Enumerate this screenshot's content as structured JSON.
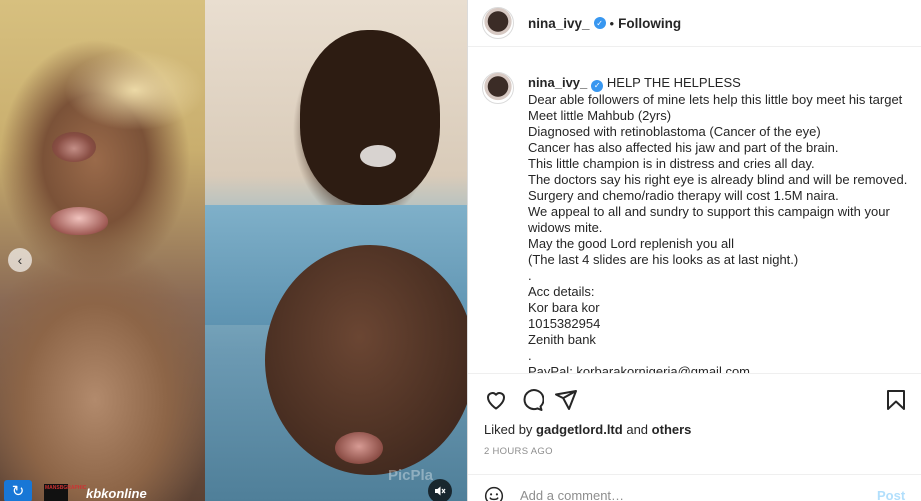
{
  "media": {
    "watermark_right": "PicPla",
    "channel_name": "kbkonline",
    "logo_text": "MANSBGRAPHIC",
    "nav_icon": "chevron-left-icon",
    "mute_icon": "speaker-muted-icon"
  },
  "header": {
    "username": "nina_ivy_",
    "separator": "•",
    "follow_state": "Following"
  },
  "caption": {
    "username": "nina_ivy_",
    "lines": [
      "HELP THE HELPLESS",
      "Dear able followers of mine lets help this little boy meet his target",
      "Meet little Mahbub (2yrs)",
      "Diagnosed with retinoblastoma (Cancer of the eye)",
      "Cancer has also affected his jaw and part of the brain.",
      "This little champion is in distress and cries all day.",
      "The doctors say his right eye is already blind and will be removed.",
      "Surgery and chemo/radio therapy will cost 1.5M naira.",
      "We appeal to all and sundry to support this campaign with your",
      "widows mite.",
      "May the good Lord replenish you all",
      "(The last 4 slides are his looks as at last night.)",
      ".",
      "Acc details:",
      "Kor bara kor",
      "1015382954",
      "Zenith bank",
      ".",
      "PayPal: korbarakornigeria@gmail.com"
    ]
  },
  "likes": {
    "prefix": "Liked by",
    "user": "gadgetlord.ltd",
    "and": "and",
    "others": "others"
  },
  "timestamp": "2 HOURS AGO",
  "comment": {
    "placeholder": "Add a comment…",
    "post_label": "Post"
  },
  "colors": {
    "verified": "#3897f0",
    "post_disabled": "#b2dffc",
    "muted_text": "#8e8e8e"
  }
}
